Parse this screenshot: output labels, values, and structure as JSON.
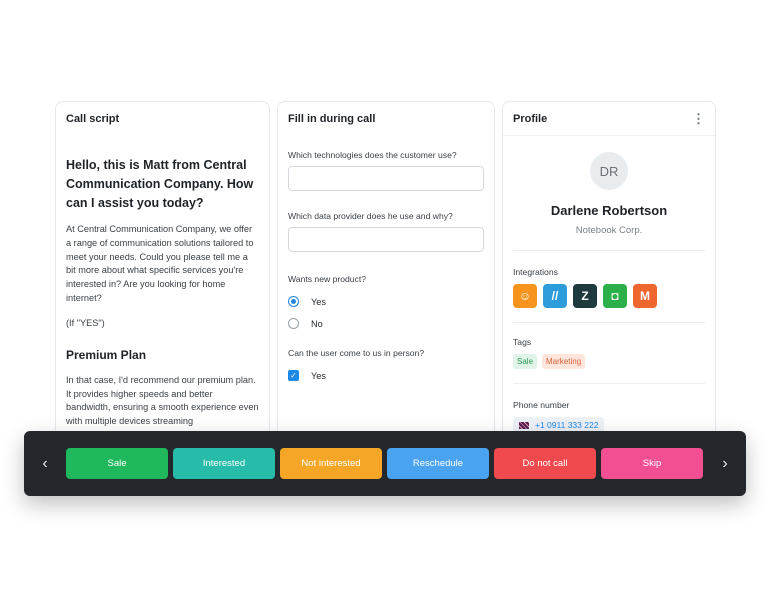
{
  "call_script": {
    "title": "Call script",
    "greeting": "Hello, this is Matt from Central Communication Company. How can I assist you today?",
    "intro": "At Central Communication Company, we offer a range of communication solutions tailored to meet your needs. Could you please tell me a bit more about what specific services you're interested in? Are you looking for home internet?",
    "note": "(If \"YES\")",
    "plan_title": "Premium Plan",
    "plan_text": "In that case, I'd recommend our premium plan. It provides higher speeds and better bandwidth, ensuring a smooth experience even with multiple devices streaming"
  },
  "form": {
    "title": "Fill in during call",
    "q1_label": "Which technologies does the customer use?",
    "q1_value": "",
    "q2_label": "Which data provider does he use and why?",
    "q2_value": "",
    "q3_label": "Wants new product?",
    "q3_options": [
      "Yes",
      "No"
    ],
    "q3_selected": "Yes",
    "q4_label": "Can the user come to us in person?",
    "q4_check_label": "Yes",
    "q4_checked": true
  },
  "profile": {
    "title": "Profile",
    "initials": "DR",
    "name": "Darlene Robertson",
    "company": "Notebook Corp.",
    "integrations_label": "Integrations",
    "integrations": [
      {
        "icon": "chat-integration-icon",
        "glyph": "☺",
        "color": "#f7941d"
      },
      {
        "icon": "freshdesk-integration-icon",
        "glyph": "//",
        "color": "#2d9cdb"
      },
      {
        "icon": "zendesk-integration-icon",
        "glyph": "Z",
        "color": "#1f3a3d"
      },
      {
        "icon": "gorgias-integration-icon",
        "glyph": "◘",
        "color": "#2bb04a"
      },
      {
        "icon": "magento-integration-icon",
        "glyph": "M",
        "color": "#ee672f"
      }
    ],
    "tags_label": "Tags",
    "tags": [
      "Sale",
      "Marketing"
    ],
    "phone_label": "Phone number",
    "phone": "+1 0911 333 222"
  },
  "actions": {
    "prev_glyph": "‹",
    "next_glyph": "›",
    "buttons": [
      {
        "label": "Sale",
        "color": "#1fb85c"
      },
      {
        "label": "Interested",
        "color": "#27bba9"
      },
      {
        "label": "Not interested",
        "color": "#f5a626"
      },
      {
        "label": "Reschedule",
        "color": "#4aa3f0"
      },
      {
        "label": "Do not call",
        "color": "#f04a4f"
      },
      {
        "label": "Skip",
        "color": "#f24f93"
      }
    ]
  },
  "colors": {
    "accent": "#1e88e5",
    "bar_background": "#24282d"
  }
}
